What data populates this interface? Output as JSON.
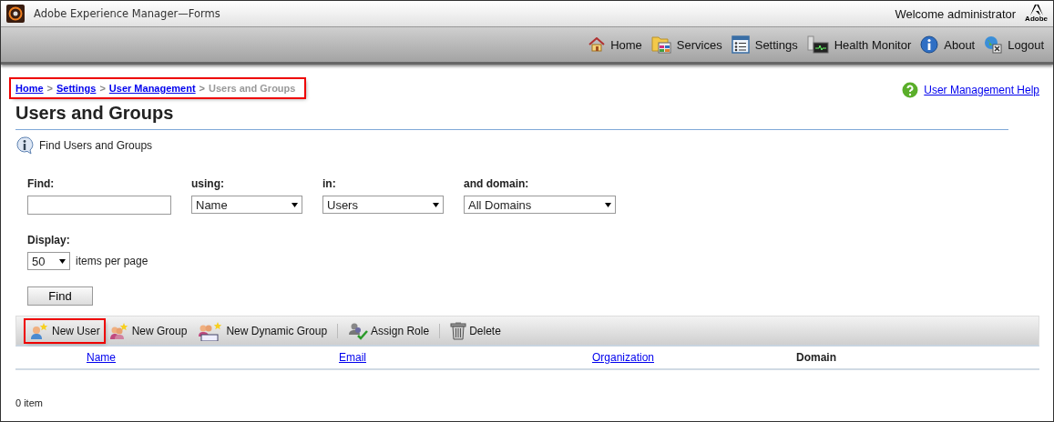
{
  "window": {
    "title": "Adobe Experience Manager—Forms",
    "welcome": "Welcome administrator",
    "brand": "Adobe"
  },
  "nav": [
    {
      "label": "Home"
    },
    {
      "label": "Services"
    },
    {
      "label": "Settings"
    },
    {
      "label": "Health Monitor"
    },
    {
      "label": "About"
    },
    {
      "label": "Logout"
    }
  ],
  "breadcrumb": {
    "highlighted": true,
    "items": [
      {
        "label": "Home",
        "link": true
      },
      {
        "label": ">",
        "link": false
      },
      {
        "label": "Settings",
        "link": true
      },
      {
        "label": ">",
        "link": false
      },
      {
        "label": "User Management",
        "link": true
      },
      {
        "label": ">",
        "link": false
      },
      {
        "label": "Users and Groups",
        "link": false
      }
    ]
  },
  "help_link": "User Management Help",
  "heading": "Users and Groups",
  "info": "Find Users and Groups",
  "fields": [
    {
      "kind": "text",
      "label": "Find:"
    },
    {
      "kind": "select",
      "label": "using:",
      "value": "Name"
    },
    {
      "kind": "select",
      "label": "in:",
      "value": "Users"
    },
    {
      "kind": "select",
      "label": "and domain:",
      "value": "All Domains"
    }
  ],
  "display": {
    "label": "Display:",
    "value": "50",
    "suffix": "items per page"
  },
  "find_button": "Find",
  "toolbar": [
    {
      "label": "New User",
      "highlighted": true
    },
    {
      "label": "New Group",
      "highlighted": false
    },
    {
      "label": "New Dynamic Group",
      "highlighted": false
    },
    {
      "label": "Assign Role",
      "highlighted": false
    },
    {
      "label": "Delete",
      "highlighted": false
    }
  ],
  "table": {
    "columns": [
      {
        "label": "Name",
        "link": true
      },
      {
        "label": "Email",
        "link": true
      },
      {
        "label": "Organization",
        "link": true
      },
      {
        "label": "Domain",
        "link": false
      }
    ]
  },
  "status": "0 item"
}
